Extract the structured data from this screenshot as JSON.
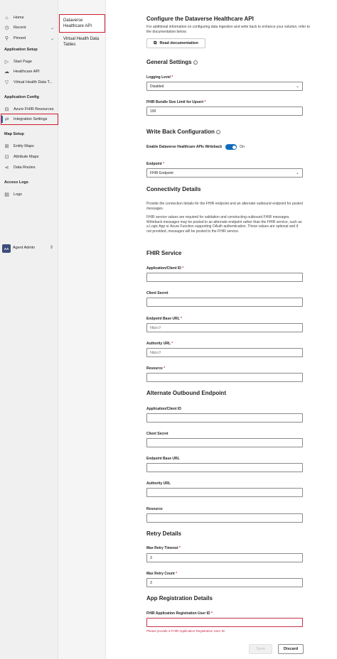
{
  "nav": {
    "home": "Home",
    "recent": "Recent",
    "pinned": "Pinned",
    "group_setup": "Application Setup",
    "start_page": "Start Page",
    "healthcare_api": "Healthcare API",
    "virtual_health": "Virtual Health Data T...",
    "group_config": "Application Config",
    "azure_fhir": "Azure FHIR Resources",
    "integration_settings": "Integration Settings",
    "group_map": "Map Setup",
    "entity_maps": "Entity Maps",
    "attribute_maps": "Attribute Maps",
    "data_routes": "Data Routes",
    "group_logs": "Access Logs",
    "logs": "Logs",
    "avatar_initials": "AA",
    "agent": "Agent Admin"
  },
  "subnav": {
    "item1": "Dataverse Healthcare API",
    "item2": "Virtual Health Data Tables"
  },
  "page": {
    "title": "Configure the Dataverse Healthcare API",
    "intro": "For additional information on configuring data ingestion and write back to enhance your solution, refer to the documentation below.",
    "read_doc": "Read documentation"
  },
  "general": {
    "heading": "General Settings",
    "logging_label": "Logging Level",
    "logging_value": "Disabled",
    "bundle_label": "FHIR Bundle Size Limit for Upsert",
    "bundle_value": "100"
  },
  "writeback": {
    "heading": "Write Back Configuration",
    "toggle_label": "Enable Dataverse Healthcare APIs Writeback",
    "toggle_state": "On",
    "endpoint_label": "Endpoint",
    "endpoint_value": "FHIR Endpoint"
  },
  "connectivity": {
    "heading": "Connectivity Details",
    "para1": "Provide the connection details for the FHIR endpoint and an alternate outbound endpoint for posted messages.",
    "para2": "FHIR service values are required for validation and constructing outbound FHIR messages. Writeback messages may be posted to an alternate endpoint rather than the FHIR service, such as a Logic App or Azure Function supporting OAuth authentication. These values are optional and if not provided, messages will be posted to the FHIR service."
  },
  "fhir": {
    "heading": "FHIR Service",
    "app_id": "Application/Client ID",
    "secret": "Client Secret",
    "base_url": "Endpoint Base URL",
    "base_url_ph": "https://",
    "authority": "Authority URL",
    "authority_ph": "https://",
    "resource": "Resource"
  },
  "alternate": {
    "heading": "Alternate Outbound Endpoint",
    "app_id": "Application/Client ID",
    "secret": "Client Secret",
    "base_url": "Endpoint Base URL",
    "authority": "Authority URL",
    "resource": "Resource"
  },
  "retry": {
    "heading": "Retry Details",
    "timeout_label": "Max Retry Timeout",
    "timeout_value": "3",
    "count_label": "Max Retry Count",
    "count_value": "3"
  },
  "appreg": {
    "heading": "App Registration Details",
    "user_id_label": "FHIR Application Registration User ID",
    "error": "Please provide a FHIR Application Registration User ID"
  },
  "actions": {
    "save": "Save",
    "discard": "Discard"
  },
  "colors": {
    "accent": "#0f6cbd",
    "error": "#c4314b",
    "highlight": "#d01a2a"
  }
}
